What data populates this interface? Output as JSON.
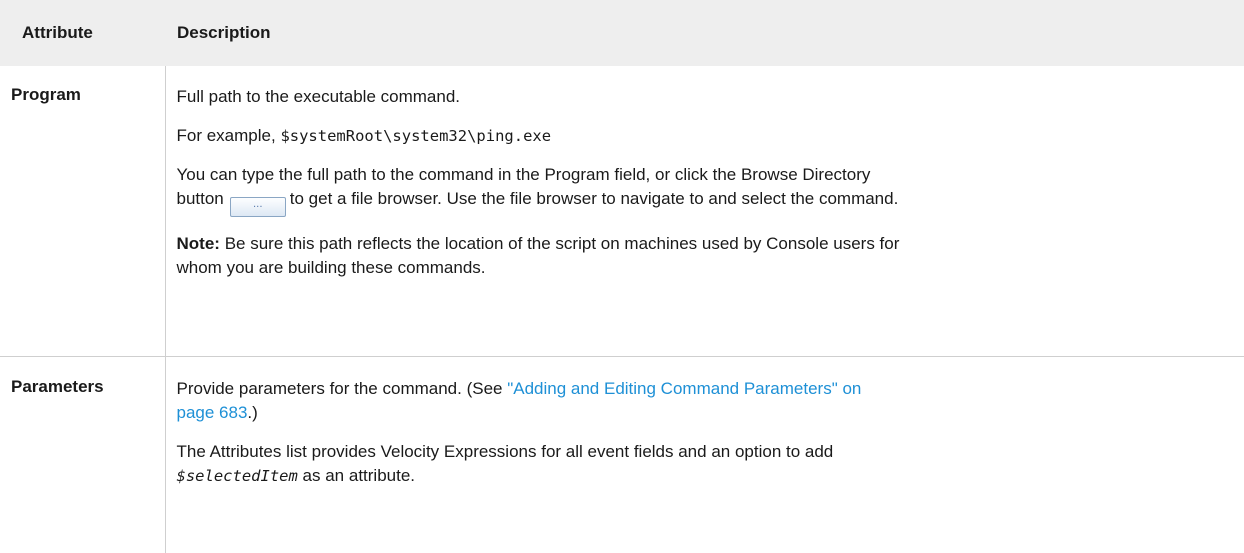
{
  "table": {
    "header": {
      "attribute": "Attribute",
      "description": "Description"
    },
    "rows": {
      "program": {
        "name": "Program",
        "p1": "Full path to the executable command.",
        "p2_prefix": "For example, ",
        "p2_code": "$systemRoot\\system32\\ping.exe",
        "p3_line1": "You can type the full path to the command in the Program field, or click the Browse Directory",
        "p3_before_button": "button",
        "browse_button_label": "...",
        "p3_after_button": "to get a file browser. Use the file browser to navigate to and select the command.",
        "note_label": "Note:",
        "note_line1": "Be sure this path reflects the location of the script on machines used by Console users for",
        "note_line2": "whom you are building these commands."
      },
      "parameters": {
        "name": "Parameters",
        "p1_prefix": "Provide parameters for the command. (See ",
        "p1_link_line1": "\"Adding and Editing Command Parameters\" on",
        "p1_link_line2": "page 683",
        "p1_suffix": ".)",
        "p2_line1": "The Attributes list provides Velocity Expressions for all event fields and an option to add",
        "p2_code": "$selectedItem",
        "p2_suffix": " as an attribute."
      }
    }
  },
  "colors": {
    "header_bg": "#eeeeee",
    "link": "#1e90d6",
    "border": "#cfcfcf"
  }
}
